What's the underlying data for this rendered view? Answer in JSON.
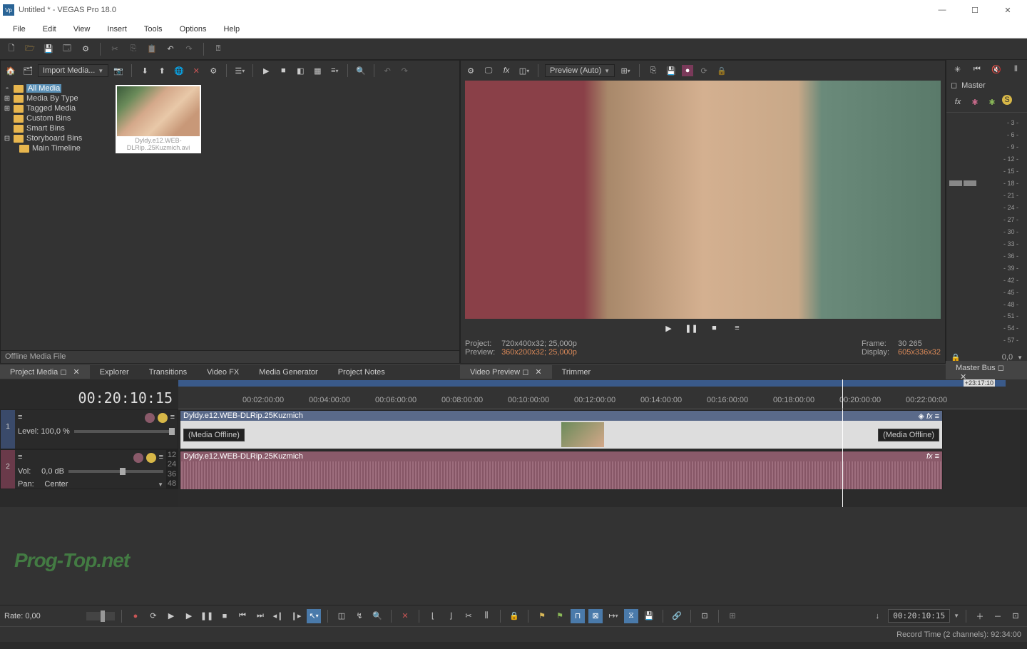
{
  "window": {
    "title": "Untitled * - VEGAS Pro 18.0"
  },
  "menu": [
    "File",
    "Edit",
    "View",
    "Insert",
    "Tools",
    "Options",
    "Help"
  ],
  "projectMedia": {
    "button": "Import Media...",
    "tree": [
      {
        "label": "All Media",
        "selected": true
      },
      {
        "label": "Media By Type"
      },
      {
        "label": "Tagged Media"
      },
      {
        "label": "Custom Bins"
      },
      {
        "label": "Smart Bins"
      },
      {
        "label": "Storyboard Bins"
      },
      {
        "label": "Main Timeline",
        "indent": true
      }
    ],
    "thumbCaption": "Dyldy.e12.WEB-DLRip..25Kuzmich.avi",
    "footer": "Offline Media File"
  },
  "leftTabs": [
    "Project Media",
    "Explorer",
    "Transitions",
    "Video FX",
    "Media Generator",
    "Project Notes"
  ],
  "preview": {
    "qualityLabel": "Preview (Auto)",
    "stats": {
      "projectLbl": "Project:",
      "projectVal": "720x400x32; 25,000p",
      "previewLbl": "Preview:",
      "previewVal": "360x200x32; 25,000p",
      "frameLbl": "Frame:",
      "frameVal": "30 265",
      "displayLbl": "Display:",
      "displayVal": "605x336x32"
    }
  },
  "previewTabs": [
    "Video Preview",
    "Trimmer"
  ],
  "master": {
    "title": "Master",
    "ticks": [
      "- 3 -",
      "- 6 -",
      "- 9 -",
      "- 12 -",
      "- 15 -",
      "- 18 -",
      "- 21 -",
      "- 24 -",
      "- 27 -",
      "- 30 -",
      "- 33 -",
      "- 36 -",
      "- 39 -",
      "- 42 -",
      "- 45 -",
      "- 48 -",
      "- 51 -",
      "- 54 -",
      "- 57 -"
    ],
    "footVal": "0,0",
    "tab": "Master Bus"
  },
  "timecode": "00:20:10:15",
  "loopEnd": "+23:17:10",
  "ruler": [
    "00:02:00:00",
    "00:04:00:00",
    "00:06:00:00",
    "00:08:00:00",
    "00:10:00:00",
    "00:12:00:00",
    "00:14:00:00",
    "00:16:00:00",
    "00:18:00:00",
    "00:20:00:00",
    "00:22:00:00"
  ],
  "tracks": {
    "video": {
      "num": "1",
      "level": "Level:  100,0 %",
      "clipName": "Dyldy.e12.WEB-DLRip.25Kuzmich",
      "offline": "(Media Offline)"
    },
    "audio": {
      "num": "2",
      "vol": "Vol:",
      "volVal": "0,0 dB",
      "pan": "Pan:",
      "panVal": "Center",
      "clipName": "Dyldy.e12.WEB-DLRip.25Kuzmich",
      "scaleLabels": [
        "12",
        "24",
        "36",
        "48"
      ]
    }
  },
  "transport": {
    "rate": "Rate: 0,00",
    "tc": "00:20:10:15"
  },
  "status": "Record Time (2 channels): 92:34:00",
  "watermark": "Prog-Top.net"
}
